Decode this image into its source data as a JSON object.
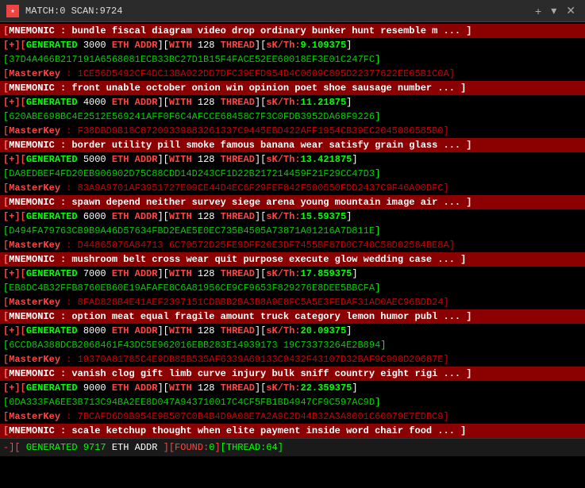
{
  "titlebar": {
    "title": "MATCH:0 SCAN:9724",
    "icon": "★",
    "new_tab": "+",
    "dropdown": "▾",
    "close": "✕"
  },
  "lines": [
    {
      "type": "mnemonic",
      "text": "MNEMONIC : bundle fiscal diagram video drop ordinary bunker hunt resemble m ... ]"
    },
    {
      "type": "generated",
      "eth_num": "3000",
      "thread": "128",
      "sk_th": "9.109375"
    },
    {
      "type": "address",
      "text": "37D4A466B217191A6568081ECB33BC27D1B15F4FACE52EE60018EF3E01C247FC"
    },
    {
      "type": "masterkey",
      "label": "MasterKey",
      "text": "1CE56D5492CF4DC13BA022DD7DFC39EFD954D4C0609C895D22377622EE05B1C0A"
    },
    {
      "type": "mnemonic",
      "text": "MNEMONIC : front unable october onion win opinion poet shoe sausage number ... ]"
    },
    {
      "type": "generated",
      "eth_num": "4000",
      "thread": "128",
      "sk_th": "11.21875"
    },
    {
      "type": "address",
      "text": "620ABE698BC4E2512E569241AFF0F6C4AFCCE68458C7F3C0FDB3952DA68F9226"
    },
    {
      "type": "masterkey",
      "label": "MasterKey",
      "text": "F38DBD9B18C87209339883261337C9445EBD422AFF1954CB39EC2045080585B0"
    },
    {
      "type": "mnemonic",
      "text": "MNEMONIC : border utility pill smoke famous banana wear satisfy grain glass ... ]"
    },
    {
      "type": "generated",
      "eth_num": "5000",
      "thread": "128",
      "sk_th": "13.421875"
    },
    {
      "type": "address",
      "text": "DA8EDBEF4FD20EB906902D75C88CDD14D243CF1D22B217214459F21F29CC47D3"
    },
    {
      "type": "masterkey",
      "label": "MasterKey",
      "text": "83A9A9701AF3951727E09CE44D4EC6F29FEF842F500550FDD2437C9F46A00DFC"
    },
    {
      "type": "mnemonic",
      "text": "MNEMONIC : spawn depend neither survey siege arena young mountain image air ... ]"
    },
    {
      "type": "generated",
      "eth_num": "6000",
      "thread": "128",
      "sk_th": "15.59375"
    },
    {
      "type": "address",
      "text": "D494FA79763CB9B9A46D57634FBD2EAE5E0EC735B4505A73871A01216A7D811E"
    },
    {
      "type": "masterkey",
      "label": "MasterKey",
      "text": "D44865076A84713 6C70572D25FE9DFF20E3DF7455BF87D0C740C58D02584BE8A"
    },
    {
      "type": "mnemonic",
      "text": "MNEMONIC : mushroom belt cross wear quit purpose execute glow wedding case ... ]"
    },
    {
      "type": "generated",
      "eth_num": "7000",
      "thread": "128",
      "sk_th": "17.859375"
    },
    {
      "type": "address",
      "text": "EB8DC4B32FFB8760EB60E19AFAFE8C6A81956CE9CF9653F829276E8DEE5BBCFA"
    },
    {
      "type": "masterkey",
      "label": "MasterKey",
      "text": "8FAD828B4E41AEF2397151CDBBB2BA3B8A9E8FC5A5E3FEDAF31AD0AEC96BDD24"
    },
    {
      "type": "mnemonic",
      "text": "MNEMONIC : option meat equal fragile amount truck category lemon humor publ ... ]"
    },
    {
      "type": "generated",
      "eth_num": "8000",
      "thread": "128",
      "sk_th": "20.09375"
    },
    {
      "type": "address",
      "text": "6CCD8A388DCB2068461F43DC5E962016EBB283E14939173 19C73373264E2B894"
    },
    {
      "type": "masterkey",
      "label": "MasterKey",
      "text": "19370A81785C4E9DB85B535AF6339A69133C9432F43107D32BAF9C990D20687E"
    },
    {
      "type": "mnemonic",
      "text": "MNEMONIC : vanish clog gift limb curve injury bulk sniff country eight rigi ... ]"
    },
    {
      "type": "generated",
      "eth_num": "9000",
      "thread": "128",
      "sk_th": "22.359375"
    },
    {
      "type": "address",
      "text": "0DA333FA6EE3B713C94BA2EE8D047A943710017C4CF5FB1BD4947CF9C597AC9D"
    },
    {
      "type": "masterkey",
      "label": "MasterKey",
      "text": "7BCAFD6D9B954E9B507C0B4B4D9A08E7A2A9C2D44B32A3A8001C60079E7EDBC9"
    },
    {
      "type": "mnemonic",
      "text": "MNEMONIC : scale ketchup thought when elite payment inside word chair food ... ]"
    }
  ],
  "footer": {
    "scan_num": "9717",
    "found": "0",
    "thread": "64"
  }
}
